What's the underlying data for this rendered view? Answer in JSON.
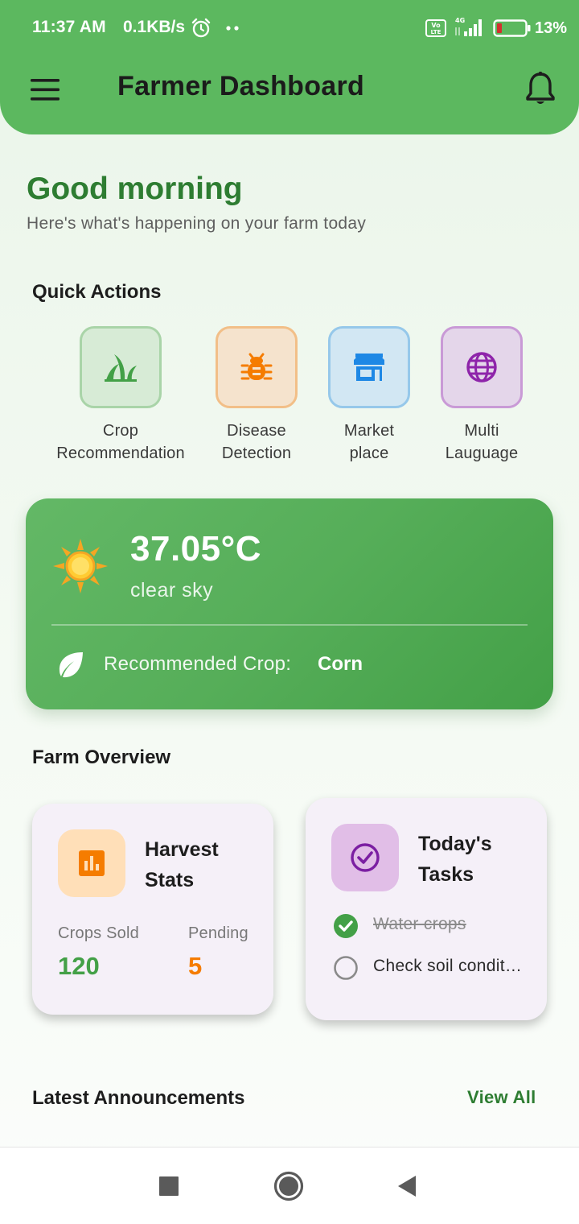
{
  "status_bar": {
    "time": "11:37 AM",
    "network_speed": "0.1KB/s",
    "battery_percent": "13%",
    "icons": [
      "alarm-icon",
      "notification-dots-icon",
      "volte-icon",
      "signal-4g-icon",
      "battery-icon"
    ]
  },
  "app_bar": {
    "title": "Farmer Dashboard",
    "menu_icon": "hamburger-menu-icon",
    "notification_icon": "bell-icon"
  },
  "greeting": {
    "title": "Good morning",
    "subtitle": "Here's what's happening on your farm today"
  },
  "quick_actions": {
    "title": "Quick Actions",
    "items": [
      {
        "label": "Crop\nRecommendation",
        "icon": "grass-icon",
        "color": "#43a047"
      },
      {
        "label": "Disease\nDetection",
        "icon": "bug-icon",
        "color": "#f57c00"
      },
      {
        "label": "Market\nplace",
        "icon": "store-icon",
        "color": "#1e88e5"
      },
      {
        "label": "Multi\nLauguage",
        "icon": "globe-icon",
        "color": "#8e24aa"
      }
    ]
  },
  "weather": {
    "temperature": "37.05°C",
    "condition": "clear sky",
    "icon": "sun-icon",
    "recommended_label": "Recommended Crop:",
    "recommended_crop": "Corn"
  },
  "farm_overview": {
    "title": "Farm Overview",
    "harvest": {
      "title": "Harvest\nStats",
      "icon": "bar-chart-icon",
      "crops_sold_label": "Crops Sold",
      "crops_sold_value": "120",
      "pending_label": "Pending",
      "pending_value": "5"
    },
    "tasks": {
      "title": "Today's\nTasks",
      "icon": "check-circle-icon",
      "items": [
        {
          "text": "Water crops",
          "done": true
        },
        {
          "text": "Check soil conditions",
          "done": false
        }
      ]
    }
  },
  "announcements": {
    "title": "Latest Announcements",
    "view_all": "View All"
  },
  "colors": {
    "primary": "#5cb85f",
    "dark_green": "#2e7d32",
    "orange": "#f57c00",
    "card_bg": "#f5f0f8"
  }
}
